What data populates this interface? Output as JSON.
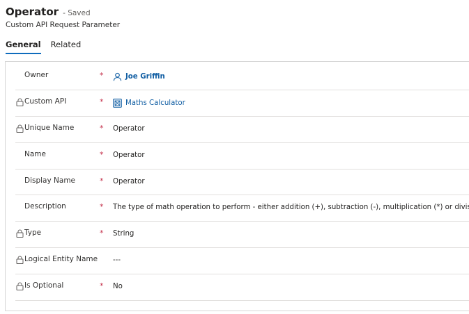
{
  "header": {
    "title": "Operator",
    "saved_status": "- Saved",
    "subtitle": "Custom API Request Parameter"
  },
  "tabs": [
    {
      "label": "General",
      "active": true
    },
    {
      "label": "Related",
      "active": false
    }
  ],
  "fields": {
    "owner": {
      "label": "Owner",
      "required": "*",
      "value": "Joe Griffin",
      "locked": false,
      "icon": "person-icon"
    },
    "custom_api": {
      "label": "Custom API",
      "required": "*",
      "value": "Maths Calculator",
      "locked": true,
      "icon": "entity-icon"
    },
    "unique_name": {
      "label": "Unique Name",
      "required": "*",
      "value": "Operator",
      "locked": true
    },
    "name": {
      "label": "Name",
      "required": "*",
      "value": "Operator",
      "locked": false
    },
    "display_name": {
      "label": "Display Name",
      "required": "*",
      "value": "Operator",
      "locked": false
    },
    "description": {
      "label": "Description",
      "required": "*",
      "value": "The type of math operation to perform - either addition (+), subtraction (-), multiplication (*) or division (/)",
      "locked": false
    },
    "type": {
      "label": "Type",
      "required": "*",
      "value": "String",
      "locked": true
    },
    "logical_entity_name": {
      "label": "Logical Entity Name",
      "required": "",
      "value": "---",
      "locked": true
    },
    "is_optional": {
      "label": "Is Optional",
      "required": "*",
      "value": "No",
      "locked": true
    }
  },
  "colors": {
    "accent": "#0f6cbd",
    "link": "#115ea3",
    "required": "#c4314b"
  }
}
